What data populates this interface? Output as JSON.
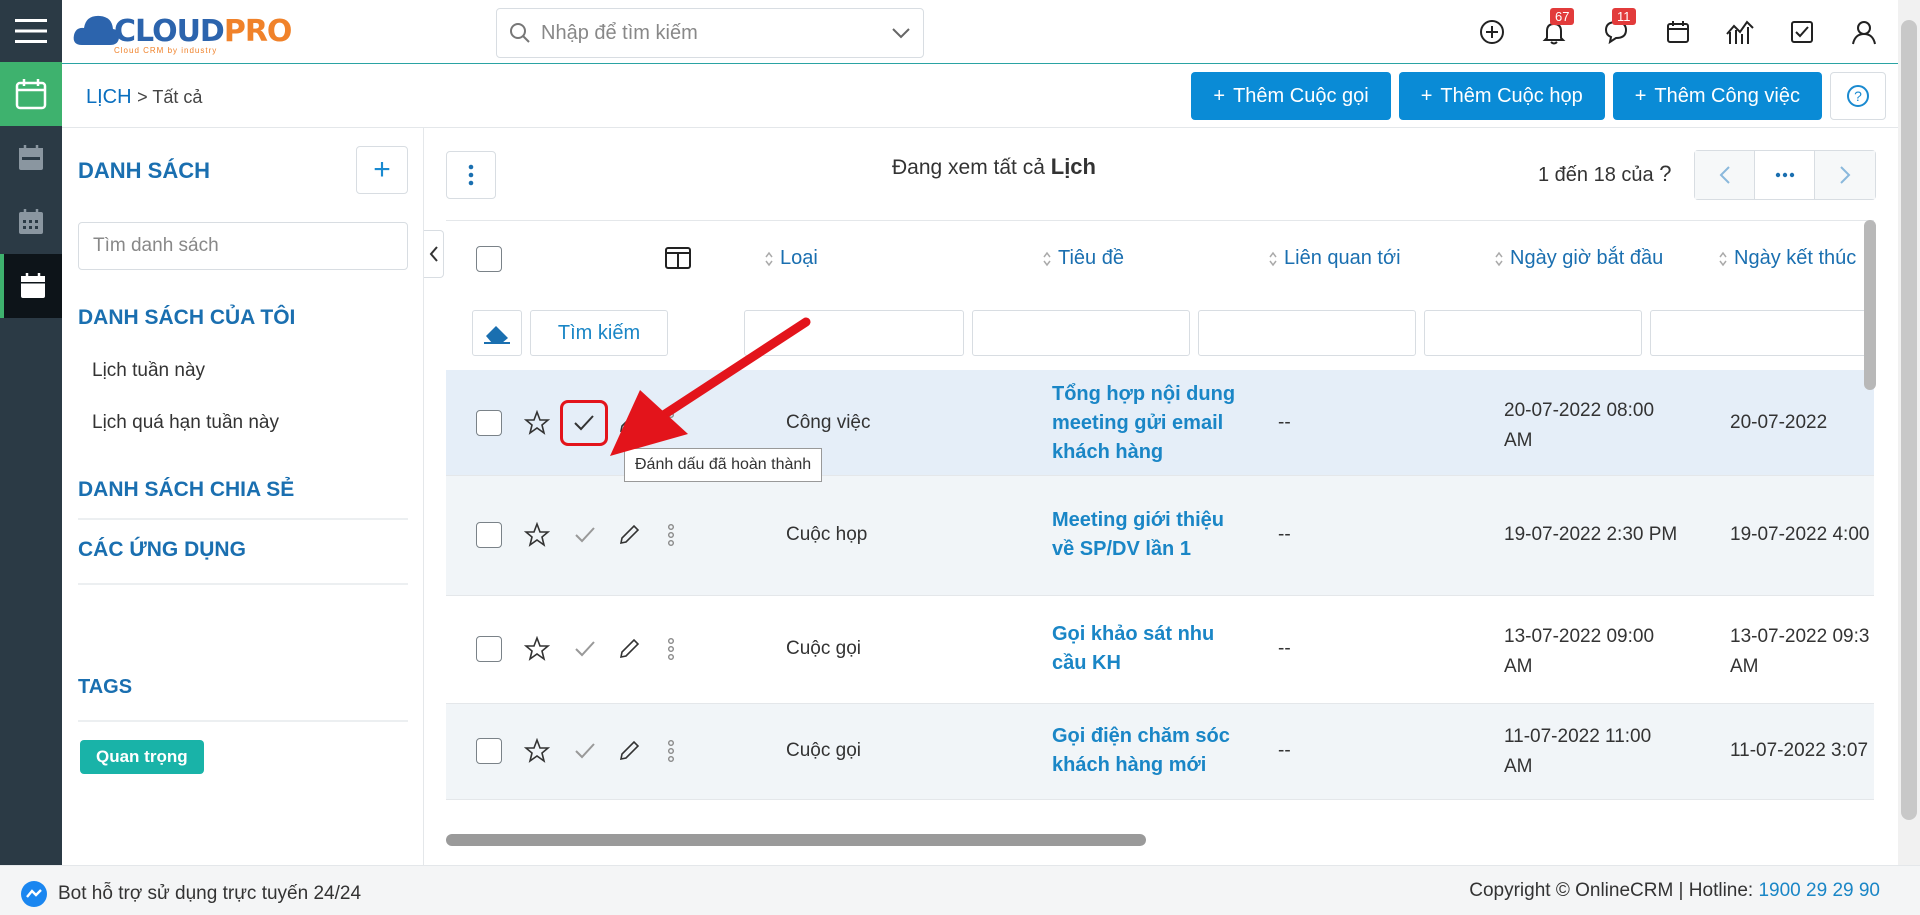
{
  "topbar": {
    "logo_word_a": "CLOUD",
    "logo_word_b": "PRO",
    "logo_tagline": "Cloud CRM by industry",
    "search_placeholder": "Nhập để tìm kiếm",
    "notif_count": "67",
    "chat_count": "11"
  },
  "subheader": {
    "module": "LỊCH",
    "sub": "Tất cả",
    "btn_call": "Thêm Cuộc gọi",
    "btn_meeting": "Thêm Cuộc họp",
    "btn_task": "Thêm Công việc"
  },
  "sidebar": {
    "title": "DANH SÁCH",
    "search_placeholder": "Tìm danh sách",
    "my_lists": "DANH SÁCH CỦA TÔI",
    "items": [
      {
        "label": "Lịch tuần này"
      },
      {
        "label": "Lịch quá hạn tuần này"
      }
    ],
    "shared": "DANH SÁCH CHIA SẺ",
    "apps": "CÁC ỨNG DỤNG",
    "tags_title": "TAGS",
    "tag": "Quan trọng"
  },
  "main": {
    "viewing_prefix": "Đang xem tất cả",
    "viewing_module": "Lịch",
    "pager_text": "1 đến 18 của",
    "pager_q": "?",
    "search_btn": "Tìm kiếm",
    "columns": [
      "Loại",
      "Tiêu đề",
      "Liên quan tới",
      "Ngày giờ bắt đầu",
      "Ngày kết thúc"
    ],
    "tooltip": "Đánh dấu đã hoàn thành",
    "rows": [
      {
        "type": "Công việc",
        "title_l1": "Tổng hợp nội dung",
        "title_l2": "meeting gửi email",
        "title_l3": "khách hàng",
        "related": "--",
        "start_l1": "20-07-2022 08:00",
        "start_l2": "AM",
        "end": "20-07-2022"
      },
      {
        "type": "Cuộc họp",
        "title_l1": "Meeting giới thiệu",
        "title_l2": "về SP/DV lần 1",
        "title_l3": "",
        "related": "--",
        "start_l1": "19-07-2022 2:30 PM",
        "start_l2": "",
        "end": "19-07-2022 4:00"
      },
      {
        "type": "Cuộc gọi",
        "title_l1": "Gọi khảo sát nhu",
        "title_l2": "cầu KH",
        "title_l3": "",
        "related": "--",
        "start_l1": "13-07-2022 09:00",
        "start_l2": "AM",
        "end": "13-07-2022 09:3",
        "end_l2": "AM"
      },
      {
        "type": "Cuộc gọi",
        "title_l1": "Gọi điện chăm sóc",
        "title_l2": "khách hàng mới",
        "title_l3": "",
        "related": "--",
        "start_l1": "11-07-2022 11:00",
        "start_l2": "AM",
        "end": "11-07-2022 3:07"
      }
    ]
  },
  "footer": {
    "bot": "Bot hỗ trợ sử dụng trực tuyến 24/24",
    "copyright": "Copyright © OnlineCRM | Hotline:",
    "hotline": "1900 29 29 90"
  },
  "colors": {
    "accent": "#0a8bd6",
    "rail": "#2b3a45",
    "rail_green": "#3eb26e",
    "link": "#1a86c6",
    "highlight_red": "#e3141b",
    "tag": "#19b3a8"
  }
}
